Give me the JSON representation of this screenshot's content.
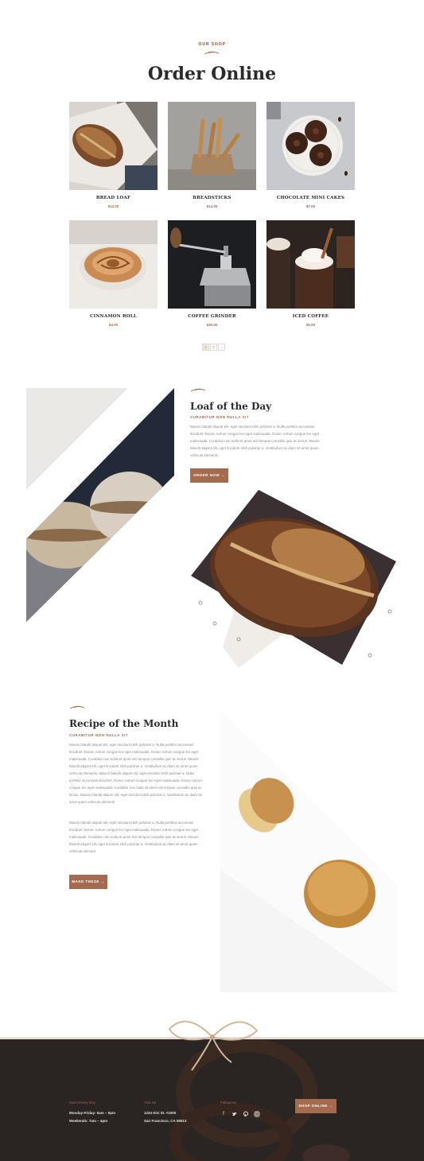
{
  "shop": {
    "eyebrow": "OUR SHOP",
    "title": "Order Online",
    "products": [
      {
        "name": "BREAD LOAF",
        "price": "$12.00"
      },
      {
        "name": "BREADSTICKS",
        "price": "$14.00"
      },
      {
        "name": "CHOCOLATE MINI CAKES",
        "price": "$7.00"
      },
      {
        "name": "CINNAMON ROLL",
        "price": "$4.00"
      },
      {
        "name": "COFFEE GRINDER",
        "price": "$30.00"
      },
      {
        "name": "ICED COFFEE",
        "price": "$5.00"
      }
    ],
    "pagination": {
      "page1": "1",
      "page2": "2",
      "next": "→"
    }
  },
  "loaf": {
    "title": "Loaf of the Day",
    "subtitle": "CURABITUR NON NULLA SIT",
    "text": "Mauris blandit aliquet elit, eget tincidunt nibh pulvinar a. Nulla porttitor accumsan tincidunt. Donec rutrum congue leo eget malesuada. Donec rutrum congue leo eget malesuada. Curabitur non nulla sit amet nisl tempus convallis quis ac lectus. Mauris blandit aliquet elit, eget tincidunt nibh pulvinar a. Vestibulum ac diam sit amet quam vehicula elementu",
    "button": "ORDER NOW →"
  },
  "recipe": {
    "title": "Recipe of the Month",
    "subtitle": "CURABITUR NON NULLA SIT",
    "text1": "Mauris blandit aliquet elit, eget tincidunt nibh pulvinar a. Nulla porttitor accumsan tincidunt. Donec rutrum congue leo eget malesuada. Donec rutrum congue leo eget malesuada. Curabitur non nulla sit amet nisl tempus convallis quis ac lectus. Mauris blandit aliquet elit, eget tincidunt nibh pulvinar a. Vestibulum ac diam sit amet quam vehicula elementu. Mauris blandit aliquet elit, eget tincidunt nibh pulvinar a. Nulla porttitor accumsan tincidunt. Donec rutrum congue leo eget malesuada. Donec rutrum congue leo eget malesuada. Curabitur non nulla sit amet nisl tempus convallis quis ac lectus. Mauris blandit aliquet elit, eget tincidunt nibh pulvinar a. Vestibulum ac diam sit amet quam vehicula elementi",
    "text2": "Mauris blandit aliquet elit, eget tincidunt nibh pulvinar a. Nulla porttitor accumsan tincidunt. Donec rutrum congue leo eget malesuada. Donec rutrum congue leo eget malesuada. Curabitur non nulla sit amet nisl tempus convallis quis ac lectus. Mauris blandit aliquet elit, eget tincidunt nibh pulvinar a. Vestibulum ac diam sit amet quam vehicula element",
    "button": "MAKE THESE →"
  },
  "footer": {
    "hours_label": "Open Every Day",
    "hours_line1": "Monday-Friday: 6am – 5pm",
    "hours_line2": "Weekends: 7am – 4pm",
    "visit_label": "Visit Us",
    "address_line1": "1234 Divi St. #1000",
    "address_line2": "San Francisco, CA 59513",
    "follow_label": "Follow Us",
    "social_icons": [
      "facebook-icon",
      "twitter-icon",
      "pinterest-icon",
      "instagram-icon"
    ],
    "shop_button": "SHOP ONLINE →"
  },
  "colors": {
    "accent": "#a56b4f",
    "heading": "#2b2b2b",
    "footer_bg": "#2a2422"
  }
}
